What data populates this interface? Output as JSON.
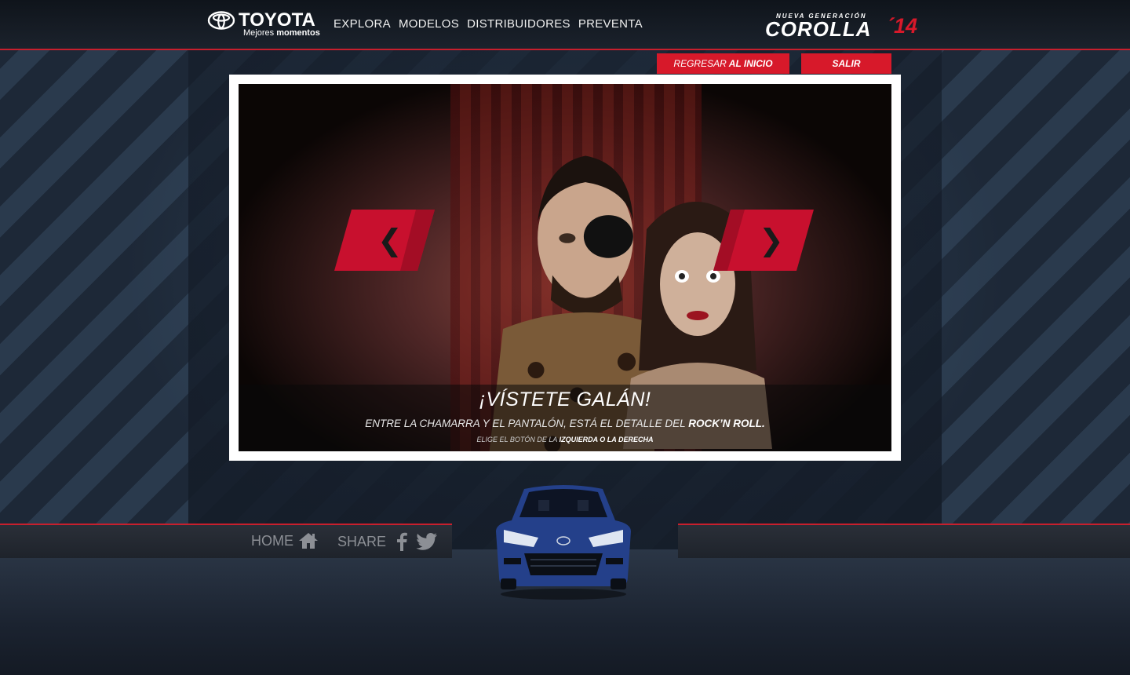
{
  "header": {
    "logo": {
      "word": "TOYOTA",
      "tagline_light": "Mejores",
      "tagline_bold": "momentos"
    },
    "nav": [
      "EXPLORA",
      "MODELOS",
      "DISTRIBUIDORES",
      "PREVENTA"
    ],
    "brand": {
      "small": "NUEVA GENERACIÓN",
      "name": "COROLLA",
      "year": "´14"
    }
  },
  "actions": {
    "home_light": "REGRESAR",
    "home_bold": "AL INICIO",
    "exit": "SALIR"
  },
  "video": {
    "title": "¡VÍSTETE GALÁN!",
    "subtitle_light": "ENTRE LA CHAMARRA Y EL PANTALÓN, ESTÁ EL DETALLE DEL",
    "subtitle_bold": "ROCK’N ROLL.",
    "hint_light": "ELIGE EL BOTÓN DE LA",
    "hint_bold": "IZQUIERDA O LA DERECHA",
    "prev_glyph": "❮",
    "next_glyph": "❯"
  },
  "footer": {
    "home": "HOME",
    "share": "SHARE"
  },
  "colors": {
    "accent": "#d7192a",
    "bar": "#0f141b",
    "text_muted": "#8c8f95"
  },
  "icons": [
    "toyota-emblem-icon",
    "house-icon",
    "facebook-icon",
    "twitter-icon",
    "chevron-left-icon",
    "chevron-right-icon"
  ]
}
